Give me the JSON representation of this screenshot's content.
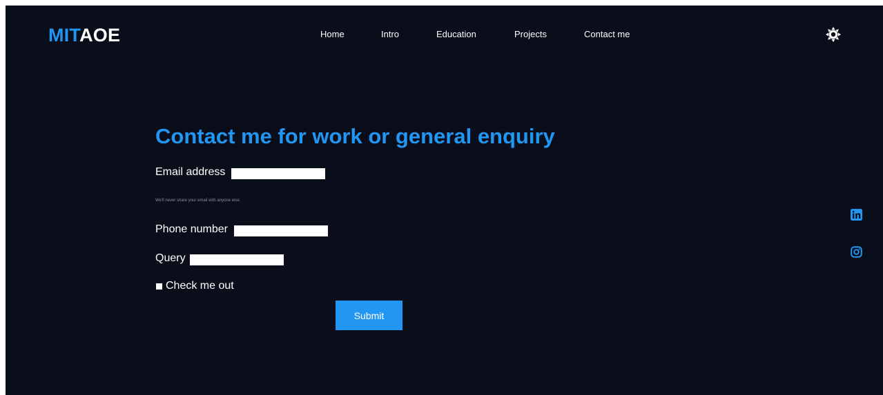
{
  "header": {
    "logo_accent": "MIT",
    "logo_rest": "AOE",
    "nav": [
      {
        "label": "Home"
      },
      {
        "label": "Intro"
      },
      {
        "label": "Education"
      },
      {
        "label": "Projects"
      },
      {
        "label": "Contact me"
      }
    ],
    "theme_icon": "gear-sun-icon"
  },
  "contact": {
    "heading": "Contact me for work or general enquiry",
    "email_label": "Email address",
    "email_value": "",
    "email_help": "We'll never share your email with anyone else.",
    "phone_label": "Phone number",
    "phone_value": "",
    "query_label": "Query",
    "query_value": "",
    "checkbox_label": "Check me out",
    "submit_label": "Submit"
  },
  "social": [
    {
      "icon": "linkedin-icon"
    },
    {
      "icon": "instagram-icon"
    }
  ],
  "colors": {
    "background": "#0a0e1a",
    "accent": "#2196f3",
    "text": "#ffffff",
    "muted": "#8a8f99"
  }
}
